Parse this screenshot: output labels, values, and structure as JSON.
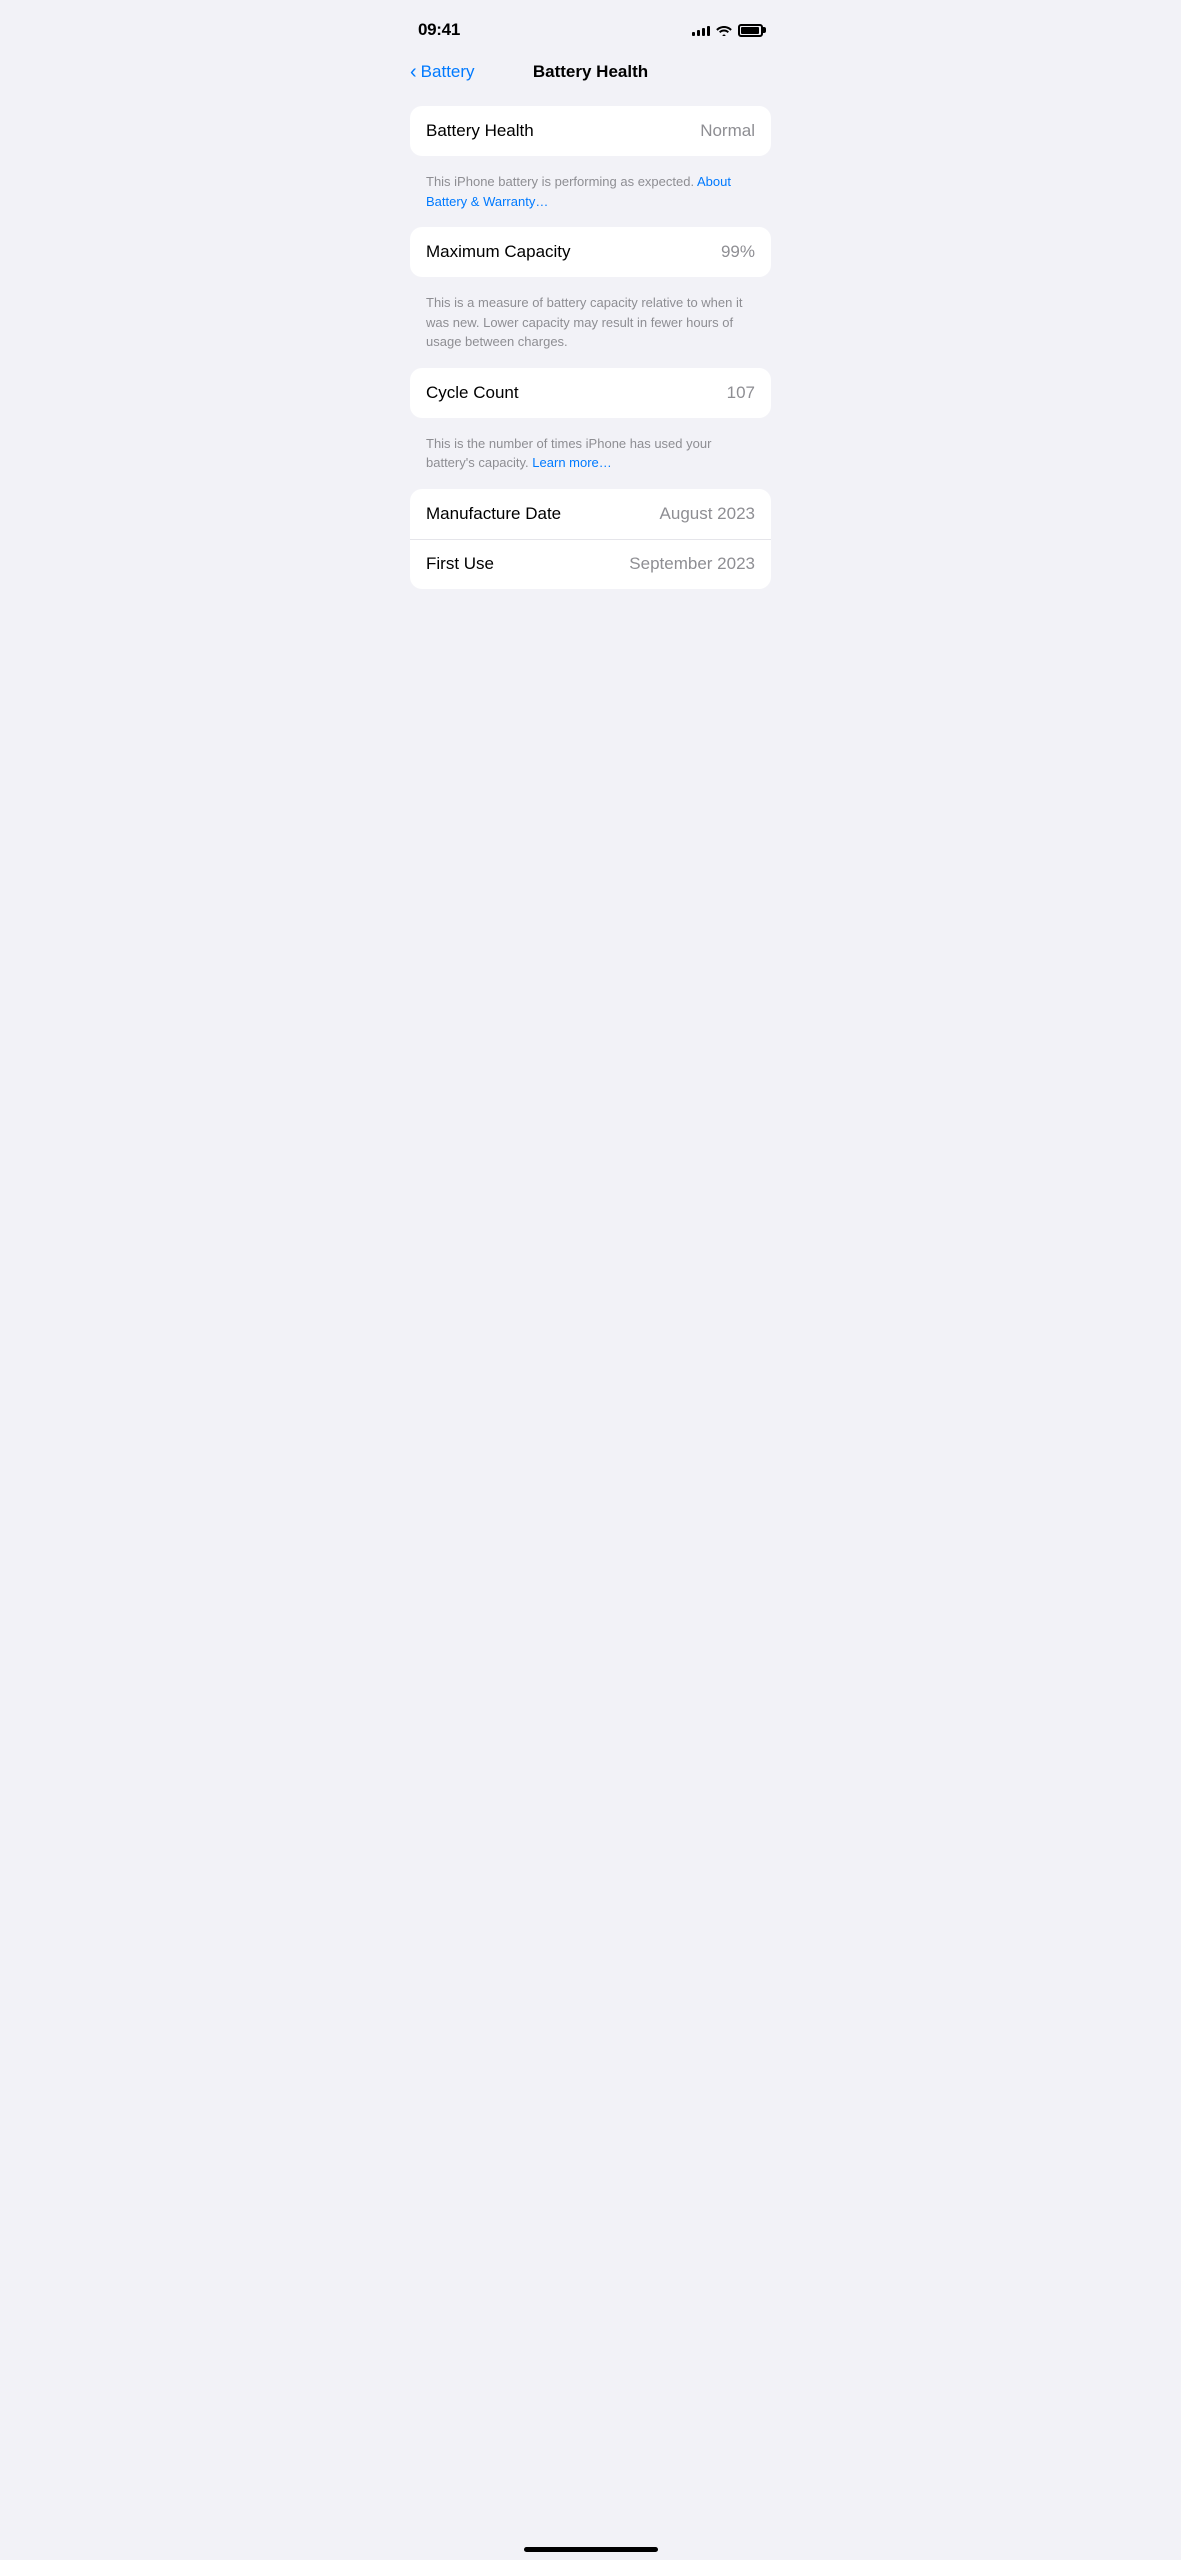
{
  "statusBar": {
    "time": "09:41",
    "batteryFillPercent": "95%"
  },
  "navBar": {
    "backLabel": "Battery",
    "title": "Battery Health"
  },
  "batteryHealthCard": {
    "label": "Battery Health",
    "value": "Normal"
  },
  "batteryHealthDescription": {
    "text": "This iPhone battery is performing as expected. ",
    "linkText": "About Battery & Warranty…"
  },
  "maximumCapacityCard": {
    "label": "Maximum Capacity",
    "value": "99%"
  },
  "maximumCapacityDescription": {
    "text": "This is a measure of battery capacity relative to when it was new. Lower capacity may result in fewer hours of usage between charges."
  },
  "cycleCountCard": {
    "label": "Cycle Count",
    "value": "107"
  },
  "cycleCountDescription": {
    "text": "This is the number of times iPhone has used your battery's capacity. ",
    "linkText": "Learn more…"
  },
  "datesCard": {
    "rows": [
      {
        "label": "Manufacture Date",
        "value": "August 2023"
      },
      {
        "label": "First Use",
        "value": "September 2023"
      }
    ]
  }
}
